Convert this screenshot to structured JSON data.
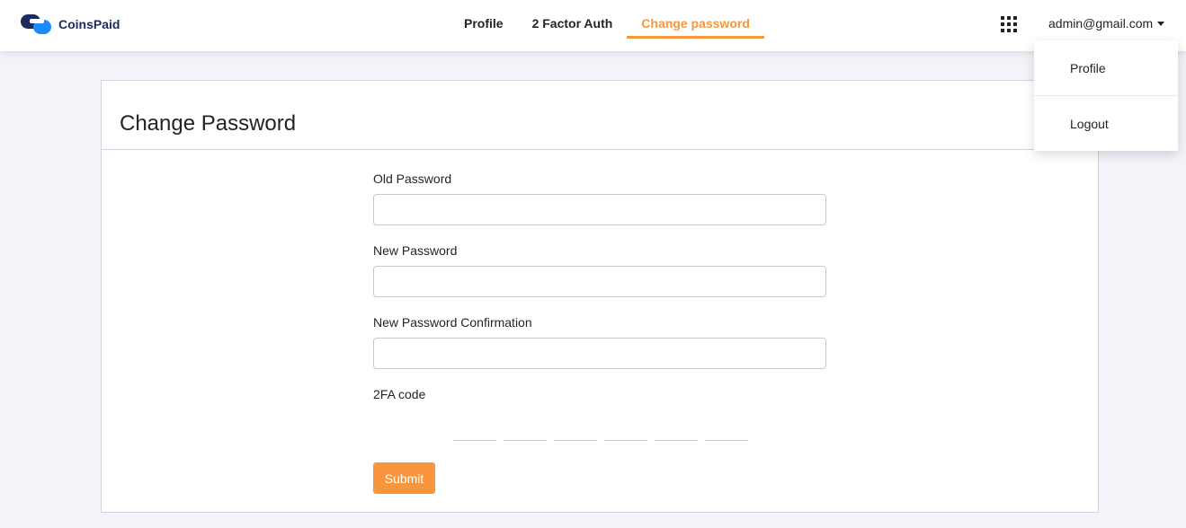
{
  "brand": {
    "name": "CoinsPaid",
    "primary_color": "#1a2b5e",
    "accent_color": "#1a8cff"
  },
  "nav": {
    "items": [
      {
        "label": "Profile",
        "active": false
      },
      {
        "label": "2 Factor Auth",
        "active": false
      },
      {
        "label": "Change password",
        "active": true
      }
    ],
    "active_color": "#f7963c"
  },
  "header": {
    "apps_icon": "grid-icon",
    "user_email": "admin@gmail.com"
  },
  "user_dropdown": {
    "items": [
      "Profile",
      "Logout"
    ]
  },
  "page": {
    "title": "Change Password"
  },
  "form": {
    "old_password_label": "Old Password",
    "new_password_label": "New Password",
    "confirm_label": "New Password Confirmation",
    "twofa_label": "2FA code",
    "otp_digits": 6,
    "submit_label": "Submit"
  }
}
